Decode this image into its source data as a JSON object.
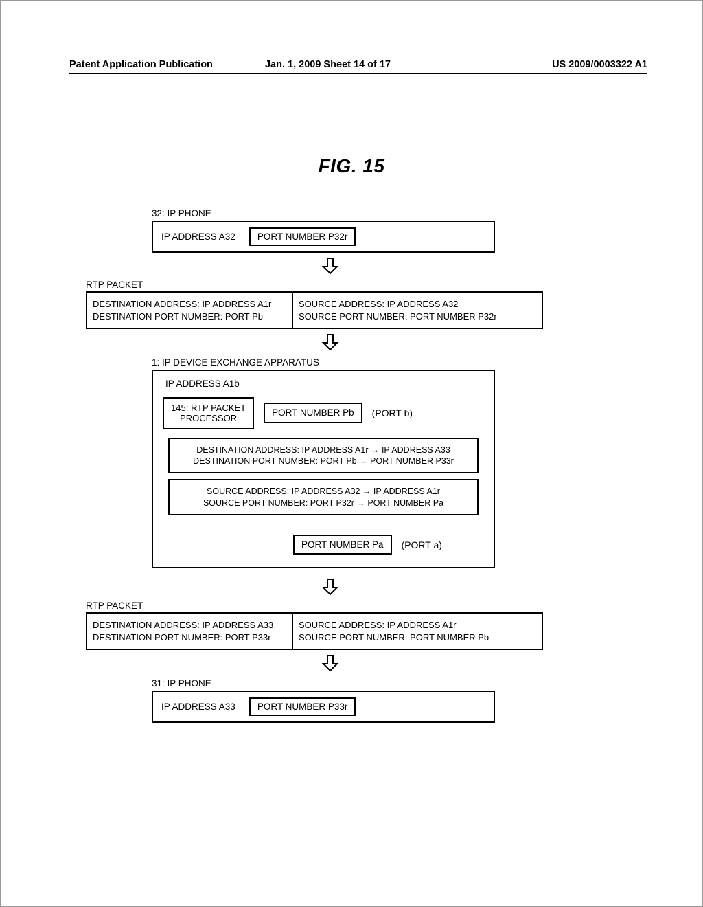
{
  "header": {
    "left": "Patent Application Publication",
    "center": "Jan. 1, 2009   Sheet 14 of 17",
    "right": "US 2009/0003322 A1"
  },
  "figure_title": "FIG. 15",
  "phone32": {
    "label": "32: IP PHONE",
    "addr": "IP ADDRESS A32",
    "port": "PORT NUMBER P32r"
  },
  "rtp1": {
    "label": "RTP PACKET",
    "dest_addr": "DESTINATION ADDRESS: IP ADDRESS A1r",
    "dest_port": "DESTINATION PORT NUMBER:  PORT Pb",
    "src_addr": "SOURCE ADDRESS:  IP ADDRESS A32",
    "src_port": "SOURCE PORT NUMBER:  PORT NUMBER P32r"
  },
  "apparatus": {
    "label": "1: IP DEVICE EXCHANGE APPARATUS",
    "addr": "IP ADDRESS A1b",
    "processor_num": "145:",
    "processor_l1": "RTP PACKET",
    "processor_l2": "PROCESSOR",
    "port_b": "PORT NUMBER Pb",
    "port_b_paren": "(PORT b)",
    "txn1_l1": "DESTINATION ADDRESS: IP ADDRESS A1r → IP ADDRESS A33",
    "txn1_l2": "DESTINATION PORT NUMBER: PORT Pb  → PORT NUMBER P33r",
    "txn2_l1": "SOURCE ADDRESS:  IP ADDRESS A32 → IP ADDRESS A1r",
    "txn2_l2": "SOURCE PORT NUMBER:  PORT P32r → PORT NUMBER Pa",
    "port_a": "PORT NUMBER Pa",
    "port_a_paren": "(PORT a)"
  },
  "rtp2": {
    "label": "RTP PACKET",
    "dest_addr": "DESTINATION ADDRESS: IP ADDRESS A33",
    "dest_port": "DESTINATION PORT NUMBER:  PORT P33r",
    "src_addr": "SOURCE ADDRESS:  IP ADDRESS A1r",
    "src_port": "SOURCE PORT NUMBER:  PORT NUMBER Pb"
  },
  "phone31": {
    "label": "31: IP PHONE",
    "addr": "IP ADDRESS A33",
    "port": "PORT NUMBER P33r"
  }
}
